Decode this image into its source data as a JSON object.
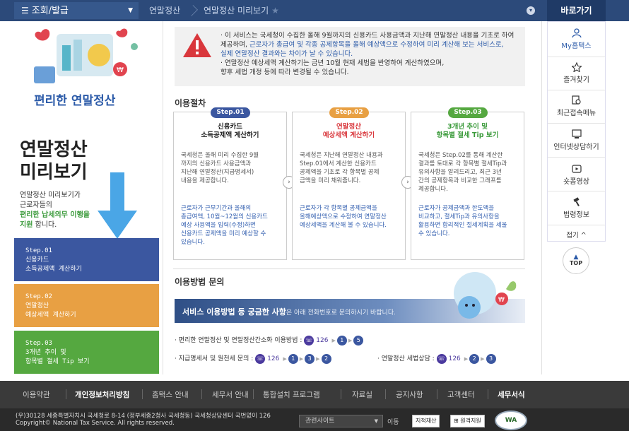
{
  "top": {
    "menu": "조회/발급",
    "crumb1": "연말정산",
    "crumb2": "연말정산 미리보기",
    "quick_title": "바로가기"
  },
  "left": {
    "brand": "편리한 연말정산",
    "title_line1": "연말정산",
    "title_line2": "미리보기",
    "desc1": "연말정산 미리보기가",
    "desc2": "근로자들의",
    "desc3_green": "편리한 납세의무 이행을",
    "desc4_green": "지원",
    "desc4_rest": " 합니다.",
    "steps": [
      {
        "n": "Step.01",
        "l1": "신용카드",
        "l2": "소득공제액 계산하기"
      },
      {
        "n": "Step.02",
        "l1": "연말정산",
        "l2": "예상세액 계산하기"
      },
      {
        "n": "Step.03",
        "l1": "3개년 추이 및",
        "l2": "항목별 절세 Tip 보기"
      }
    ]
  },
  "notice": {
    "p1a": "· 이 서비스는 국세청이 수집한 올해 9월까지의 신용카드 사용금액과 지난해 연말정산 내용을 기초로 하여",
    "p1b": "제공하며, ",
    "p1b_blue": "근로자가 총급여 및 각종 공제항목을 올해 예상액으로 수정하여 미리 계산해 보는 서비스로,",
    "p1c_blue": "실제 연말정산 결과와는 차이가 날 수 있습니다.",
    "p2a": "· 연말정산 예상세액 계산하기는 금년 10월 현재 세법을 반영하여 계산하였으며,",
    "p2b": "향후 세법 개정 등에 따라 변경될 수 있습니다."
  },
  "procedure": {
    "title": "이용절차",
    "cards": [
      {
        "pill": "Step.01",
        "h1": "신용카드",
        "h2": "소득공제액 계산하기",
        "body": [
          "국세청은 올해 미리 수집한 9월",
          "까지의 신용카드 사용금액과",
          "지난해 연말정산(지급명세서)",
          "내용을 제공합니다."
        ],
        "note": [
          "근로자가 근무기간과 올해의",
          "총급여액, 10월~12월의 신용카드",
          "예상 사용액을 입력(수정)하면",
          "신용카드 공제액을 미리 예상할 수",
          "있습니다."
        ]
      },
      {
        "pill": "Step.02",
        "h1": "연말정산",
        "h2": "예상세액 계산하기",
        "body": [
          "국세청은 지난해 연말정산 내용과",
          "Step.01에서 계산한 신용카드",
          "공제액을 기초로 각 항목별 공제",
          "금액을 미리 채워줍니다."
        ],
        "note": [
          "근로자가 각 항목별 공제금액을",
          "올해예상액으로 수정하여 연말정산",
          "예상세액을 계산해 볼 수 있습니다."
        ]
      },
      {
        "pill": "Step.03",
        "h1": "3개년 추이 및",
        "h2": "항목별 절세 Tip 보기",
        "body": [
          "국세청은 Step.02를 통해 계산한",
          "결과를 토대로 각 항목별 절세Tip과",
          "유의사항을 알려드리고, 최근 3년",
          "간의 공제항목과 비교한 그래프를",
          "제공합니다."
        ],
        "note": [
          "근로자가 공제금액과 한도액을",
          "비교하고, 절세Tip과 유의사항을",
          "활용하면 합리적인 절세계획을 세울",
          "수 있습니다."
        ]
      }
    ]
  },
  "inquiry": {
    "title": "이용방법 문의",
    "bar_bold": "서비스 이용방법 등 궁금한 사항",
    "bar_rest": "은 아래 전화번호로 문의하시기 바랍니다.",
    "line1": "· 편리한 연말정산 및 연말정산간소화 이용방법 :",
    "line2": "· 지급명세서 및 원천세 문의 :",
    "line3": "· 연말정산 세법상담 :",
    "phone": "126",
    "l1n": [
      "1",
      "5"
    ],
    "l2n": [
      "1",
      "3",
      "2"
    ],
    "l3n": [
      "2",
      "3"
    ]
  },
  "quick": [
    {
      "icon": "person-icon",
      "label": "My홈택스"
    },
    {
      "icon": "star-icon",
      "label": "즐겨찾기"
    },
    {
      "icon": "recent-icon",
      "label": "최근접속메뉴"
    },
    {
      "icon": "consult-icon",
      "label": "인터넷상담하기"
    },
    {
      "icon": "video-icon",
      "label": "숏폼영상"
    },
    {
      "icon": "gavel-icon",
      "label": "법령정보"
    }
  ],
  "quick_fold": "접기 ^",
  "top_btn": "TOP",
  "footer": {
    "nav": [
      {
        "t": "이용약관"
      },
      {
        "t": "개인정보처리방침",
        "bold": true
      },
      {
        "t": "홈택스 안내"
      },
      {
        "t": "세무서 안내"
      },
      {
        "t": "통합설치 프로그램"
      },
      {
        "t": "자료실"
      },
      {
        "t": "공지사항"
      },
      {
        "t": "고객센터"
      },
      {
        "t": "세무서식",
        "bold": true
      }
    ],
    "addr": "(우)30128 세종특별자치시 국세청로 8-14 (정부세종2청사 국세청동) 국세청상담센터 국번없이 126",
    "copy": "Copyright© National Tax Service. All rights reserved.",
    "related": "관련사이트",
    "go": "이동",
    "b1": "지적재산",
    "b2": "원격지원",
    "wa": "WA"
  }
}
